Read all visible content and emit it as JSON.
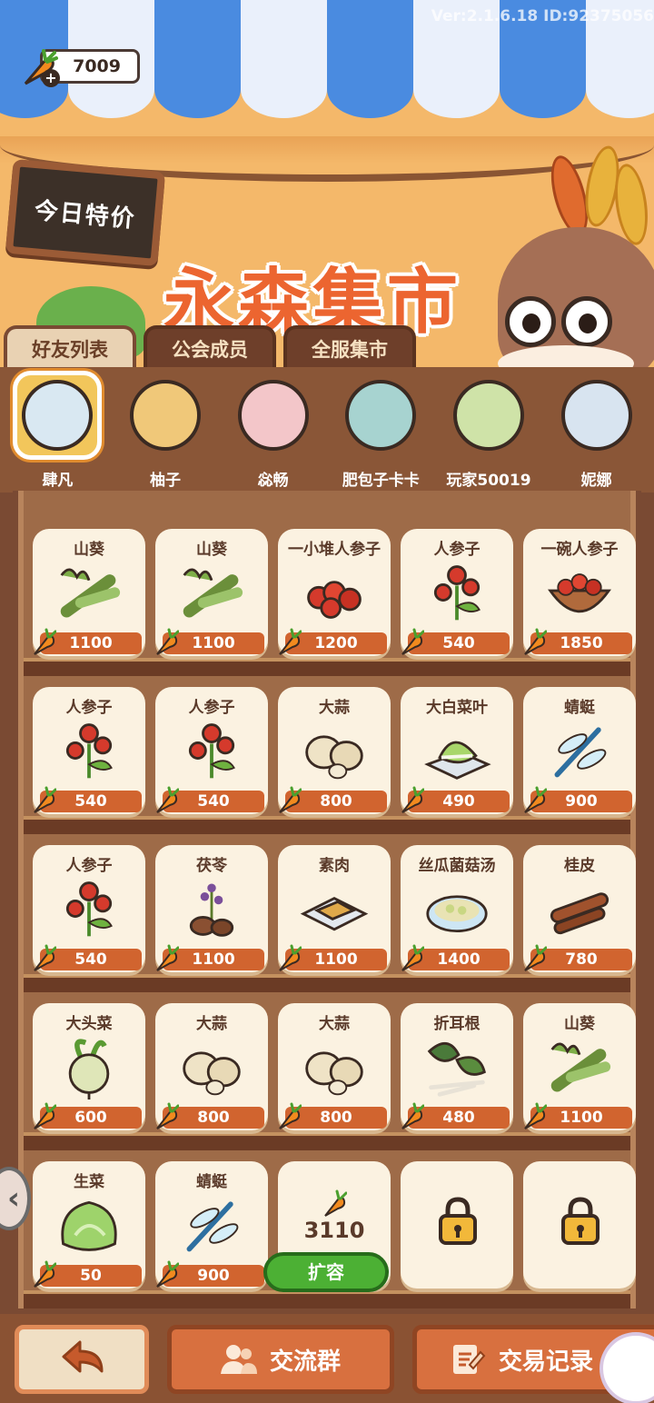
{
  "header": {
    "version": "Ver:2.1.6.18 ID:92375056",
    "currency": "7009",
    "sign": "今日特价",
    "title": "永森集市"
  },
  "tabs": [
    {
      "label": "好友列表",
      "active": true
    },
    {
      "label": "公会成员",
      "active": false
    },
    {
      "label": "全服集市",
      "active": false
    }
  ],
  "friends": [
    {
      "name": "肆凡",
      "selected": true
    },
    {
      "name": "柚子",
      "selected": false
    },
    {
      "name": "惢畅",
      "selected": false
    },
    {
      "name": "肥包子卡卡",
      "selected": false
    },
    {
      "name": "玩家50019",
      "selected": false
    },
    {
      "name": "妮娜",
      "selected": false
    }
  ],
  "shelf": {
    "rows": [
      [
        {
          "name": "山葵",
          "price": "1100",
          "icon": "wasabi-icon"
        },
        {
          "name": "山葵",
          "price": "1100",
          "icon": "wasabi-icon"
        },
        {
          "name": "一小堆人参子",
          "price": "1200",
          "icon": "ginseng-berries-pile-icon"
        },
        {
          "name": "人参子",
          "price": "540",
          "icon": "ginseng-berry-icon"
        },
        {
          "name": "一碗人参子",
          "price": "1850",
          "icon": "ginseng-berries-bowl-icon"
        }
      ],
      [
        {
          "name": "人参子",
          "price": "540",
          "icon": "ginseng-berry-icon"
        },
        {
          "name": "人参子",
          "price": "540",
          "icon": "ginseng-berry-icon"
        },
        {
          "name": "大蒜",
          "price": "800",
          "icon": "garlic-icon"
        },
        {
          "name": "大白菜叶",
          "price": "490",
          "icon": "cabbage-leaf-icon"
        },
        {
          "name": "蜻蜓",
          "price": "900",
          "icon": "dragonfly-icon"
        }
      ],
      [
        {
          "name": "人参子",
          "price": "540",
          "icon": "ginseng-berry-icon"
        },
        {
          "name": "茯苓",
          "price": "1100",
          "icon": "poria-icon"
        },
        {
          "name": "素肉",
          "price": "1100",
          "icon": "vegetarian-meat-icon"
        },
        {
          "name": "丝瓜菌菇汤",
          "price": "1400",
          "icon": "soup-bowl-icon"
        },
        {
          "name": "桂皮",
          "price": "780",
          "icon": "cinnamon-icon"
        }
      ],
      [
        {
          "name": "大头菜",
          "price": "600",
          "icon": "turnip-icon"
        },
        {
          "name": "大蒜",
          "price": "800",
          "icon": "garlic-icon"
        },
        {
          "name": "大蒜",
          "price": "800",
          "icon": "garlic-icon"
        },
        {
          "name": "折耳根",
          "price": "480",
          "icon": "houttuynia-icon"
        },
        {
          "name": "山葵",
          "price": "1100",
          "icon": "wasabi-icon"
        }
      ],
      [
        {
          "name": "生菜",
          "price": "50",
          "icon": "lettuce-icon"
        },
        {
          "name": "蜻蜓",
          "price": "900",
          "icon": "dragonfly-icon"
        }
      ]
    ],
    "expand_cost": "3110",
    "expand_label": "扩容"
  },
  "bottom": {
    "group_label": "交流群",
    "log_label": "交易记录"
  },
  "colors": {
    "awning_blue": "#4a8be0",
    "price_bg": "#d1642f",
    "expand_green": "#4cb034",
    "title_orange": "#ec6530"
  }
}
